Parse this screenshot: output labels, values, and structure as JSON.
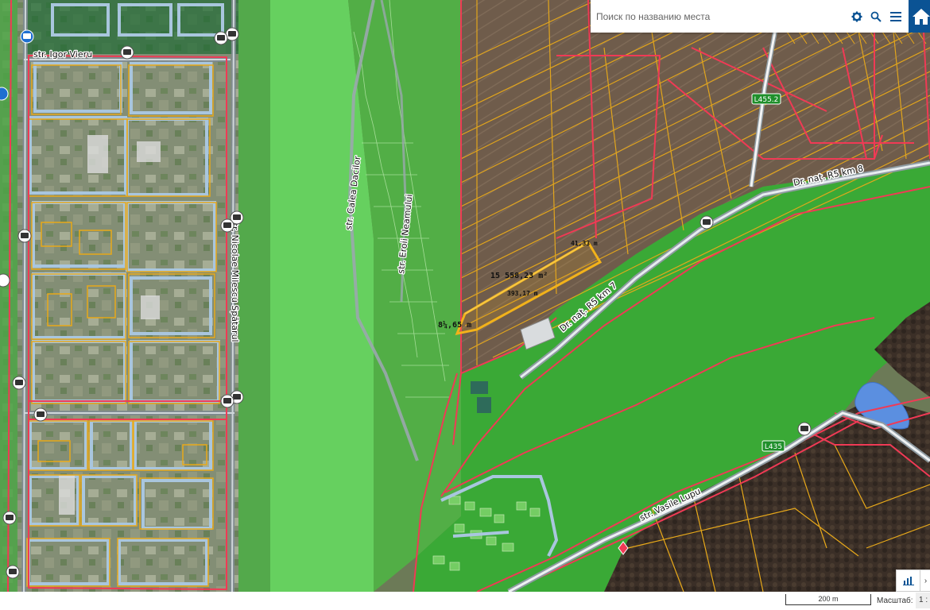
{
  "search": {
    "placeholder": "Поиск по названию места"
  },
  "streets": {
    "igor_vieru": "str. Igor Vieru",
    "nicolae_milescu": "str. Nicolae Milescu Spătarul",
    "calea_dacilor": "str. Calea Dacilor",
    "eroii_neamului": "str. Eroii Neamului",
    "dr_nat_r5_km8": "Dr. naț. R5 km 8",
    "dr_nat_r5_km7": "Dr. naț. R5 km 7",
    "vasile_lupu": "str. Vasile Lupu"
  },
  "road_badges": {
    "l4552": "L455.2",
    "l435": "L435"
  },
  "measurements": {
    "len_top": "41,33 m",
    "area": "15 558,23 m²",
    "len_long": "393,17 m",
    "len_left": "8¼,65 m"
  },
  "scale": {
    "bar_label": "200 m",
    "label": "Масштаб:",
    "value": "1 :"
  },
  "colors": {
    "parcel_outline": "#e8a91a",
    "zone_outline": "#f03a55",
    "green_zone": "#3fb53c",
    "bright_green_zone": "#5ed05a",
    "building_outline": "#a9c6de",
    "home_button": "#0b5394",
    "water": "#5b8fe0"
  },
  "icons": [
    "gear-icon",
    "search-icon",
    "menu-icon",
    "home-icon",
    "bus-stop-icon",
    "chart-icon",
    "collapse-icon"
  ]
}
